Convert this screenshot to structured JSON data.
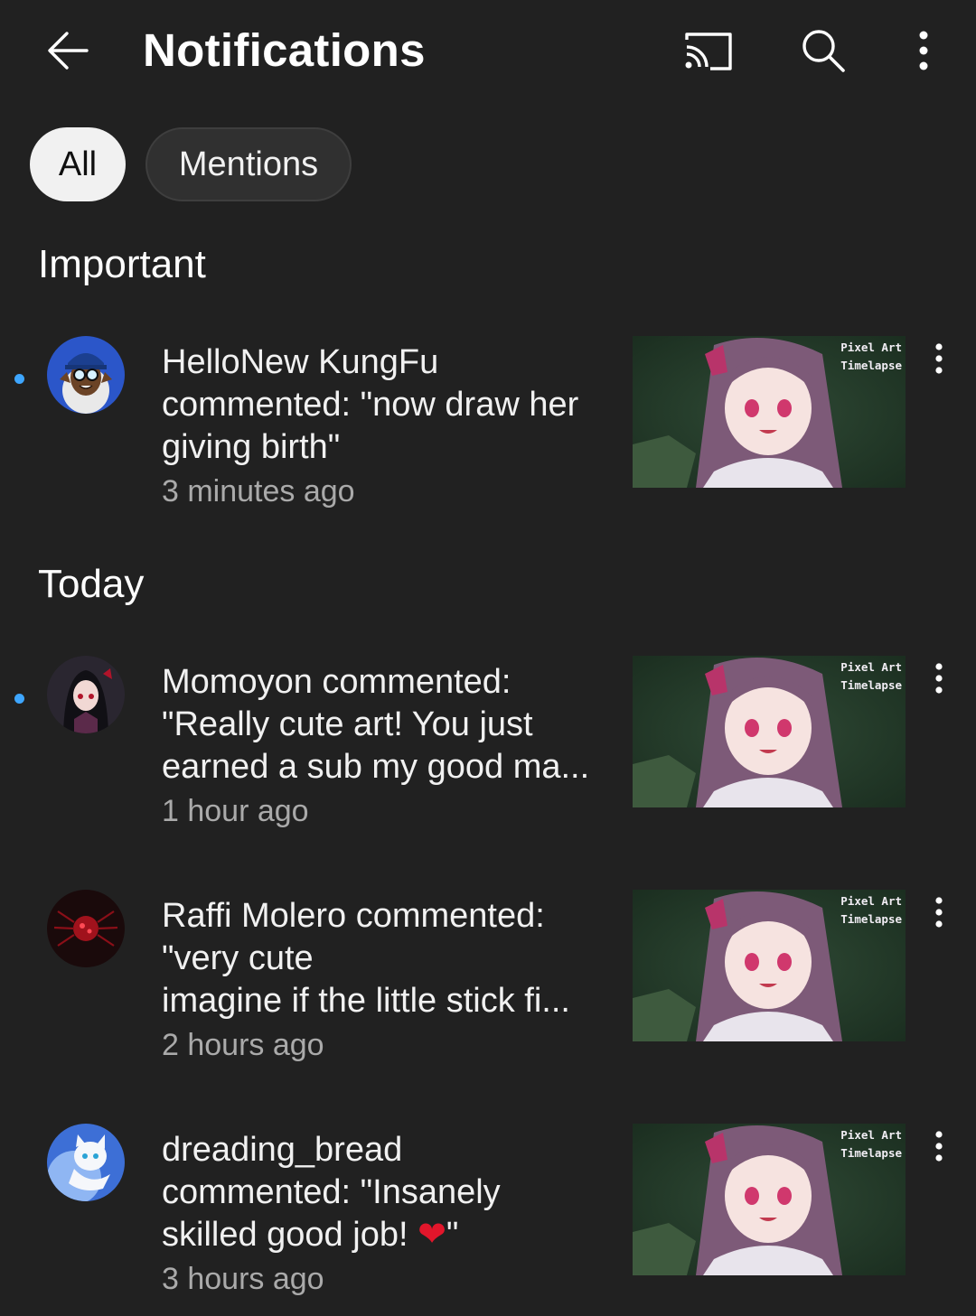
{
  "header": {
    "title": "Notifications",
    "back_icon": "arrow-left-icon",
    "cast_icon": "cast-icon",
    "search_icon": "search-icon",
    "more_icon": "more-vertical-icon"
  },
  "filters": {
    "all_label": "All",
    "mentions_label": "Mentions",
    "selected": "All"
  },
  "sections": {
    "important": "Important",
    "today": "Today"
  },
  "thumbnail": {
    "line1": "Pixel Art",
    "line2": "Timelapse"
  },
  "notifications": [
    {
      "lines": [
        "HelloNew KungFu",
        "commented: \"now draw her",
        "giving birth\""
      ],
      "time": "3 minutes ago",
      "unread": true
    },
    {
      "lines": [
        "Momoyon commented:",
        "\"Really cute art! You just",
        "earned a sub my good ma..."
      ],
      "time": "1 hour ago",
      "unread": true
    },
    {
      "lines": [
        "Raffi Molero commented:",
        "\"very cute",
        "imagine if the little stick fi..."
      ],
      "time": "2 hours ago",
      "unread": false
    },
    {
      "lines": [
        "dreading_bread",
        "commented: \"Insanely",
        "skilled good job! "
      ],
      "emoji": "❤",
      "closing": "\"",
      "time": "3 hours ago",
      "unread": false
    }
  ],
  "colors": {
    "background": "#212121",
    "unread_dot": "#3ea6ff",
    "secondary_text": "#aaaaaa",
    "chip_selected": "#f1f1f1",
    "chip_unselected": "#303030"
  }
}
